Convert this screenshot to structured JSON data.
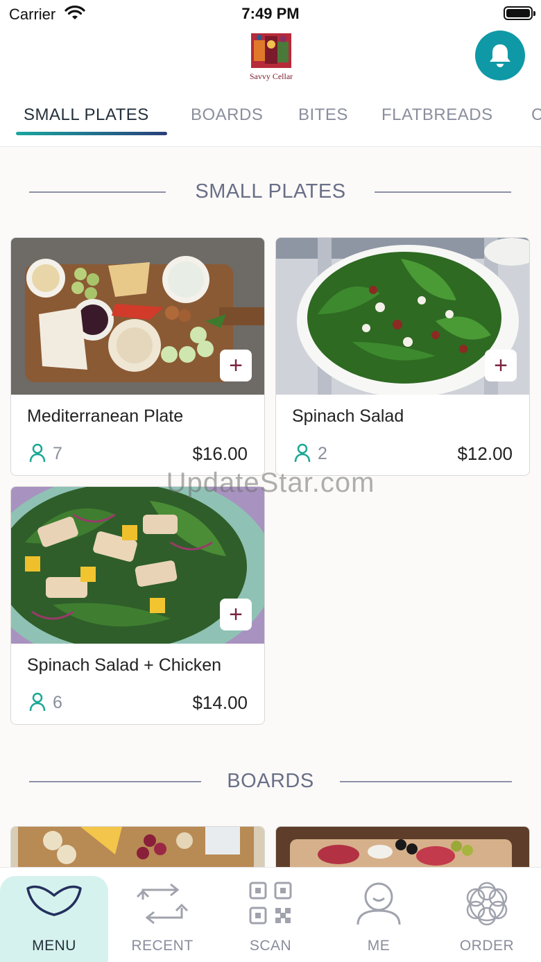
{
  "status": {
    "carrier": "Carrier",
    "time": "7:49 PM"
  },
  "brand": {
    "logo_text": "Savvy Cellar"
  },
  "tabs": [
    {
      "label": "SMALL PLATES"
    },
    {
      "label": "BOARDS"
    },
    {
      "label": "BITES"
    },
    {
      "label": "FLATBREADS"
    },
    {
      "label": "C"
    }
  ],
  "sections": [
    {
      "title": "SMALL PLATES"
    },
    {
      "title": "BOARDS"
    }
  ],
  "items": [
    {
      "name": "Mediterranean Plate",
      "count": "7",
      "price": "$16.00",
      "add": "+"
    },
    {
      "name": "Spinach Salad",
      "count": "2",
      "price": "$12.00",
      "add": "+"
    },
    {
      "name": "Spinach Salad + Chicken",
      "count": "6",
      "price": "$14.00",
      "add": "+"
    }
  ],
  "watermark": "UpdateStar.com",
  "nav": [
    {
      "label": "MENU",
      "icon": "menu-icon"
    },
    {
      "label": "RECENT",
      "icon": "recent-icon"
    },
    {
      "label": "SCAN",
      "icon": "qr-scan-icon"
    },
    {
      "label": "ME",
      "icon": "person-icon"
    },
    {
      "label": "ORDER",
      "icon": "order-icon"
    }
  ],
  "colors": {
    "accent": "#0f99a6",
    "brand_wine": "#7a2440",
    "nav_active_bg": "#d6f2ee"
  }
}
